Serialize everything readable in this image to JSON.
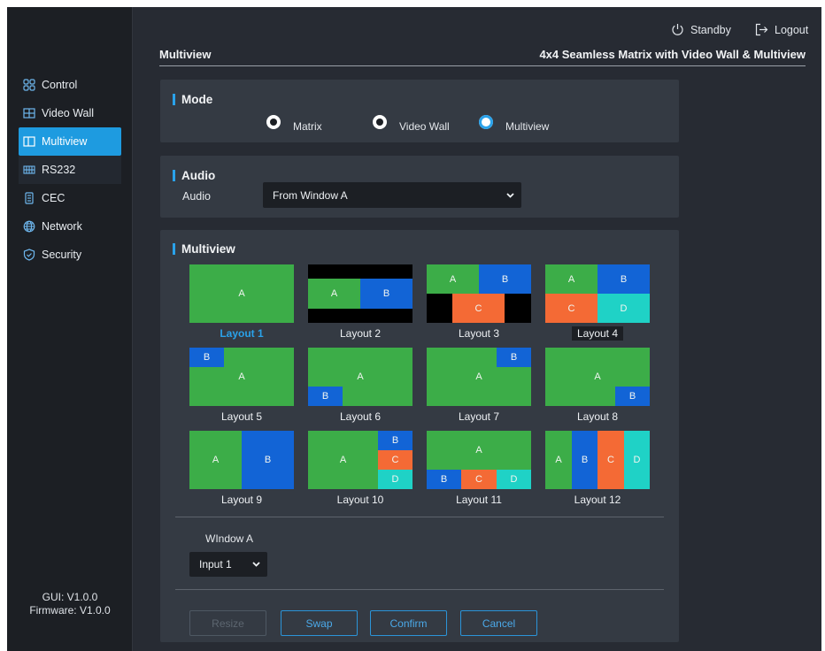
{
  "sidebar": {
    "items": [
      {
        "label": "Control",
        "icon": "grid-four-icon"
      },
      {
        "label": "Video Wall",
        "icon": "video-wall-icon"
      },
      {
        "label": "Multiview",
        "icon": "multiview-icon"
      },
      {
        "label": "RS232",
        "icon": "serial-port-icon"
      },
      {
        "label": "CEC",
        "icon": "remote-icon"
      },
      {
        "label": "Network",
        "icon": "globe-icon"
      },
      {
        "label": "Security",
        "icon": "shield-icon"
      }
    ],
    "active_index": 2,
    "gui_version": "GUI: V1.0.0",
    "firmware_version": "Firmware: V1.0.0"
  },
  "header": {
    "standby_label": "Standby",
    "logout_label": "Logout",
    "page_title": "Multiview",
    "device_title": "4x4 Seamless Matrix with Video Wall & Multiview"
  },
  "mode": {
    "title": "Mode",
    "options": [
      "Matrix",
      "Video Wall",
      "Multiview"
    ],
    "selected": "Multiview"
  },
  "audio": {
    "title": "Audio",
    "label": "Audio",
    "value": "From Window A"
  },
  "multiview": {
    "title": "Multiview",
    "selected_layout": "Layout 1",
    "layouts": [
      {
        "label": "Layout 1",
        "cells": [
          "A"
        ]
      },
      {
        "label": "Layout 2",
        "cells": [
          "A",
          "B"
        ]
      },
      {
        "label": "Layout 3",
        "cells": [
          "A",
          "B",
          "C"
        ]
      },
      {
        "label": "Layout 4",
        "cells": [
          "A",
          "B",
          "C",
          "D"
        ]
      },
      {
        "label": "Layout 5",
        "cells": [
          "B",
          "A"
        ]
      },
      {
        "label": "Layout 6",
        "cells": [
          "A",
          "B"
        ]
      },
      {
        "label": "Layout 7",
        "cells": [
          "B",
          "A"
        ]
      },
      {
        "label": "Layout 8",
        "cells": [
          "A",
          "B"
        ]
      },
      {
        "label": "Layout 9",
        "cells": [
          "A",
          "B"
        ]
      },
      {
        "label": "Layout 10",
        "cells": [
          "A",
          "B",
          "C",
          "D"
        ]
      },
      {
        "label": "Layout 11",
        "cells": [
          "A",
          "B",
          "C",
          "D"
        ]
      },
      {
        "label": "Layout 12",
        "cells": [
          "A",
          "B",
          "C",
          "D"
        ]
      }
    ],
    "window_label": "WIndow A",
    "window_input": "Input 1",
    "buttons": {
      "resize": "Resize",
      "swap": "Swap",
      "confirm": "Confirm",
      "cancel": "Cancel"
    }
  },
  "colors": {
    "accent": "#1e9be0",
    "window_green": "#3cad48",
    "window_blue": "#1264d6",
    "window_orange": "#f46a35",
    "window_cyan": "#1fd2c6"
  }
}
